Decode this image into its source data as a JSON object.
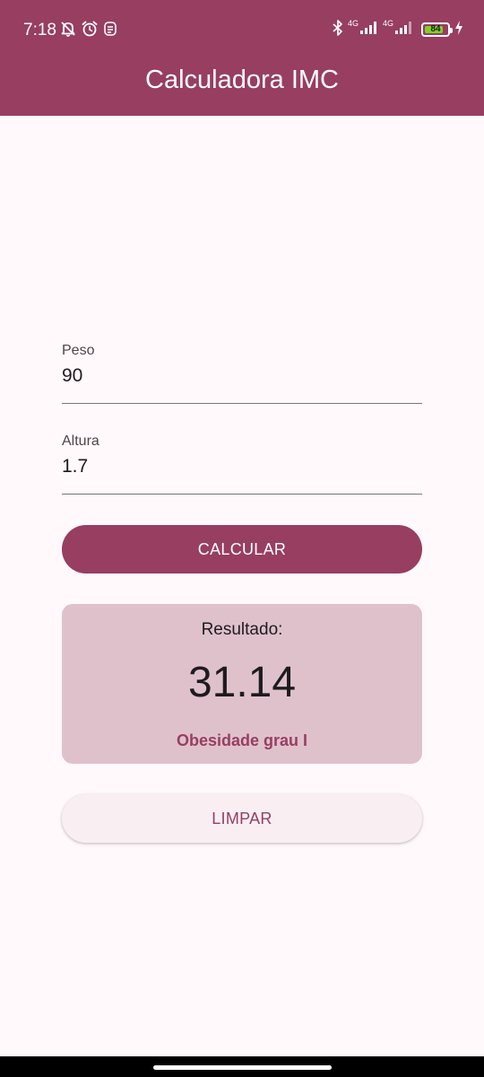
{
  "status_bar": {
    "time": "7:18",
    "left_icons": [
      "bell-off-icon",
      "alarm-icon",
      "app-notification-icon"
    ],
    "right_icons": [
      "bluetooth-icon",
      "signal-icon",
      "signal-icon",
      "battery-icon",
      "charging-icon"
    ],
    "network_1": "4G",
    "network_2": "4G",
    "battery_level": "84",
    "battery_fraction": 0.84,
    "battery_color": "#7ED321"
  },
  "app_bar": {
    "title": "Calculadora IMC",
    "color": "#973E61"
  },
  "form": {
    "peso": {
      "label": "Peso",
      "value": "90"
    },
    "altura": {
      "label": "Altura",
      "value": "1.7"
    }
  },
  "buttons": {
    "calcular_label": "CALCULAR",
    "limpar_label": "LIMPAR"
  },
  "result": {
    "label": "Resultado:",
    "value": "31.14",
    "classification": "Obesidade grau I",
    "card_color": "#DFC1CC",
    "accent_color": "#973E61"
  }
}
